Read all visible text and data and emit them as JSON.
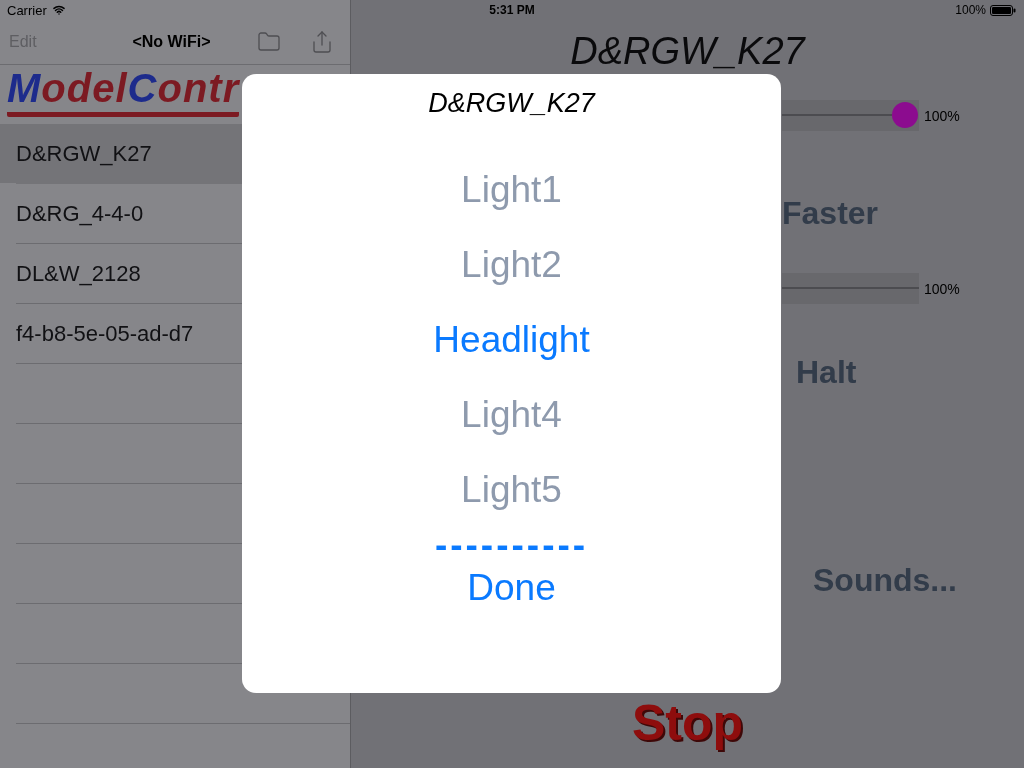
{
  "status_bar": {
    "carrier": "Carrier",
    "time": "5:31 PM",
    "battery": "100%"
  },
  "sidebar": {
    "nav": {
      "edit_button": {
        "label": "Edit",
        "disabled": true
      },
      "title": "<No WiFi>"
    },
    "logo": "ModelContr",
    "items": [
      {
        "label": "D&RGW_K27",
        "selected": true
      },
      {
        "label": "D&RG_4-4-0",
        "selected": false
      },
      {
        "label": "DL&W_2128",
        "selected": false
      },
      {
        "label": "f4-b8-5e-05-ad-d7",
        "selected": false
      }
    ]
  },
  "main": {
    "title": "D&RGW_K27",
    "controls": [
      {
        "kind": "slider",
        "level": 1,
        "reading": "100%"
      },
      {
        "kind": "button",
        "label": "Faster"
      },
      {
        "kind": "meter",
        "level": 1,
        "reading": "100%"
      },
      {
        "kind": "button",
        "label": "Halt"
      },
      {
        "kind": "button",
        "label": "Sounds..."
      }
    ],
    "stop_button": "Stop"
  },
  "dialog": {
    "title": "D&RGW_K27",
    "options": [
      {
        "label": "Light1",
        "selected": false
      },
      {
        "label": "Light2",
        "selected": false
      },
      {
        "label": "Headlight",
        "selected": true
      },
      {
        "label": "Light4",
        "selected": false
      },
      {
        "label": "Light5",
        "selected": false
      }
    ],
    "separator": "----------",
    "done_button": "Done"
  }
}
